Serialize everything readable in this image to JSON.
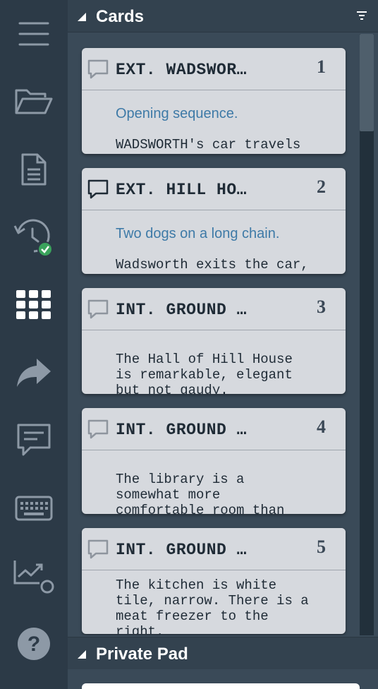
{
  "sidebar": {
    "items": [
      {
        "icon": "hamburger-menu-icon"
      },
      {
        "icon": "folder-open-icon"
      },
      {
        "icon": "document-icon"
      },
      {
        "icon": "history-saved-icon"
      },
      {
        "icon": "grid-cards-icon",
        "active": true
      },
      {
        "icon": "share-arrow-icon"
      },
      {
        "icon": "comment-icon"
      },
      {
        "icon": "keyboard-icon"
      },
      {
        "icon": "stats-chart-icon"
      },
      {
        "icon": "help-icon"
      }
    ]
  },
  "cards_panel": {
    "title": "Cards",
    "cards": [
      {
        "title": "EXT. WADSWOR…",
        "number": "1",
        "synopsis": "Opening sequence.",
        "body": "WADSWORTH's car travels",
        "comment_filled": false
      },
      {
        "title": "EXT. HILL HO…",
        "number": "2",
        "synopsis": "Two dogs on a long chain.",
        "body": "Wadsworth exits the car,",
        "comment_filled": true
      },
      {
        "title": "INT. GROUND …",
        "number": "3",
        "synopsis": "",
        "body": "The Hall of Hill House\nis remarkable, elegant\nbut not gaudy.",
        "comment_filled": false
      },
      {
        "title": "INT. GROUND …",
        "number": "4",
        "synopsis": "",
        "body": "The library is a\nsomewhat more\ncomfortable room than",
        "comment_filled": false
      },
      {
        "title": "INT. GROUND …",
        "number": "5",
        "synopsis": "",
        "body": "The kitchen is white\ntile, narrow. There is a\nmeat freezer to the\nright.",
        "comment_filled": false
      }
    ]
  },
  "private_pad": {
    "title": "Private Pad"
  },
  "colors": {
    "rail_bg": "#2c3a47",
    "panel_bg": "#3a4a58",
    "card_bg": "#d6d9de",
    "synopsis": "#3e7aa7",
    "saved_badge": "#3aa35c"
  }
}
